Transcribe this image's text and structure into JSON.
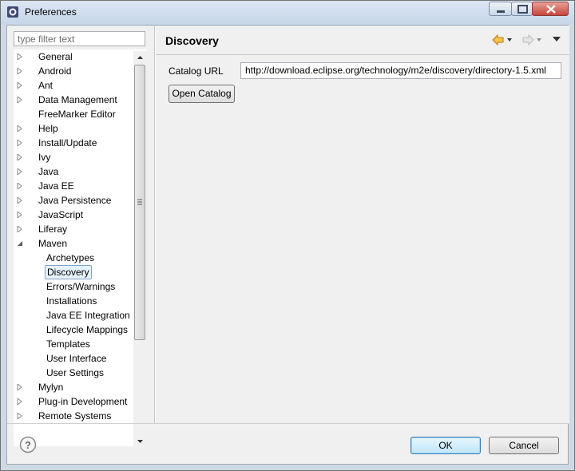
{
  "window": {
    "title": "Preferences"
  },
  "filter": {
    "placeholder": "type filter text",
    "value": ""
  },
  "tree": {
    "items": [
      {
        "label": "General",
        "level": 0,
        "expandable": true,
        "expanded": false
      },
      {
        "label": "Android",
        "level": 0,
        "expandable": true,
        "expanded": false
      },
      {
        "label": "Ant",
        "level": 0,
        "expandable": true,
        "expanded": false
      },
      {
        "label": "Data Management",
        "level": 0,
        "expandable": true,
        "expanded": false
      },
      {
        "label": "FreeMarker Editor",
        "level": 0,
        "expandable": false,
        "expanded": false
      },
      {
        "label": "Help",
        "level": 0,
        "expandable": true,
        "expanded": false
      },
      {
        "label": "Install/Update",
        "level": 0,
        "expandable": true,
        "expanded": false
      },
      {
        "label": "Ivy",
        "level": 0,
        "expandable": true,
        "expanded": false
      },
      {
        "label": "Java",
        "level": 0,
        "expandable": true,
        "expanded": false
      },
      {
        "label": "Java EE",
        "level": 0,
        "expandable": true,
        "expanded": false
      },
      {
        "label": "Java Persistence",
        "level": 0,
        "expandable": true,
        "expanded": false
      },
      {
        "label": "JavaScript",
        "level": 0,
        "expandable": true,
        "expanded": false
      },
      {
        "label": "Liferay",
        "level": 0,
        "expandable": true,
        "expanded": false
      },
      {
        "label": "Maven",
        "level": 0,
        "expandable": true,
        "expanded": true
      },
      {
        "label": "Archetypes",
        "level": 1,
        "expandable": false,
        "expanded": false
      },
      {
        "label": "Discovery",
        "level": 1,
        "expandable": false,
        "expanded": false,
        "selected": true
      },
      {
        "label": "Errors/Warnings",
        "level": 1,
        "expandable": false,
        "expanded": false
      },
      {
        "label": "Installations",
        "level": 1,
        "expandable": false,
        "expanded": false
      },
      {
        "label": "Java EE Integration",
        "level": 1,
        "expandable": false,
        "expanded": false
      },
      {
        "label": "Lifecycle Mappings",
        "level": 1,
        "expandable": false,
        "expanded": false
      },
      {
        "label": "Templates",
        "level": 1,
        "expandable": false,
        "expanded": false
      },
      {
        "label": "User Interface",
        "level": 1,
        "expandable": false,
        "expanded": false
      },
      {
        "label": "User Settings",
        "level": 1,
        "expandable": false,
        "expanded": false
      },
      {
        "label": "Mylyn",
        "level": 0,
        "expandable": true,
        "expanded": false
      },
      {
        "label": "Plug-in Development",
        "level": 0,
        "expandable": true,
        "expanded": false
      },
      {
        "label": "Remote Systems",
        "level": 0,
        "expandable": true,
        "expanded": false
      }
    ]
  },
  "page": {
    "title": "Discovery",
    "catalog_url_label": "Catalog URL",
    "catalog_url_value": "http://download.eclipse.org/technology/m2e/discovery/directory-1.5.xml",
    "open_catalog_label": "Open Catalog"
  },
  "buttons": {
    "ok": "OK",
    "cancel": "Cancel"
  },
  "colors": {
    "back_arrow": "#e8a320",
    "forward_arrow_disabled": "#c8c8c8",
    "selection_bg": "#e5f3fb",
    "selection_border": "#7da2ce",
    "default_button_border": "#3c7fb1"
  },
  "icons": {
    "app": "eclipse-icon",
    "minimize": "minimize-icon",
    "maximize": "maximize-icon",
    "close": "close-icon",
    "back": "back-arrow-icon",
    "forward": "forward-arrow-icon",
    "menu": "view-menu-icon",
    "help": "help-icon"
  }
}
